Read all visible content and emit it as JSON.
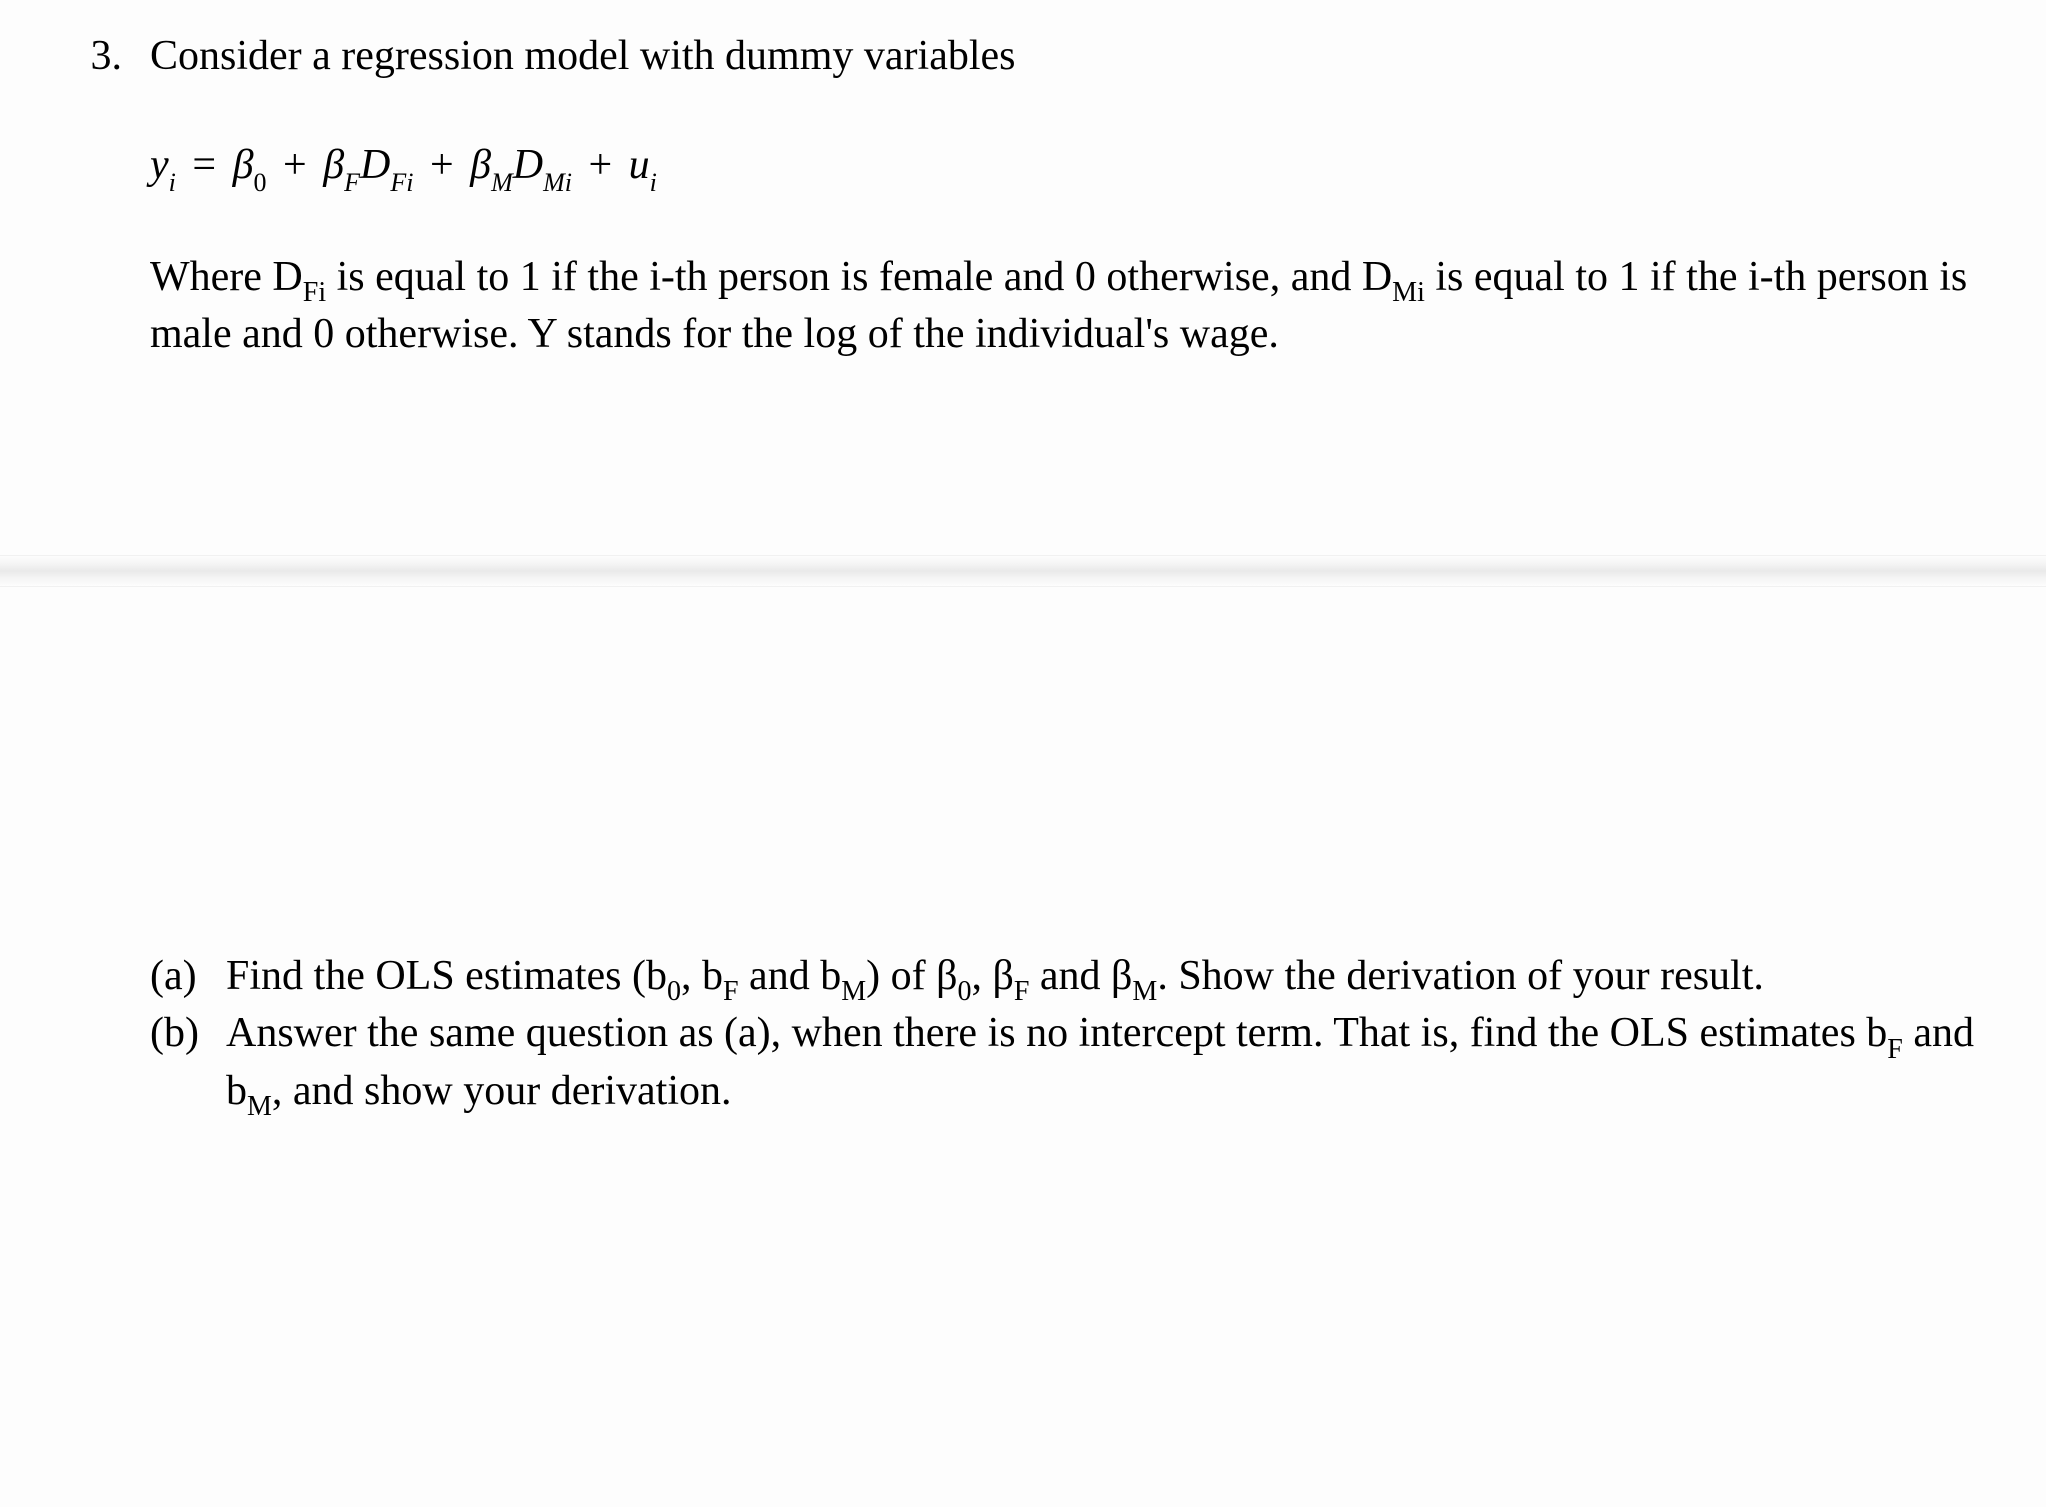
{
  "question": {
    "number": "3.",
    "intro": "Consider a regression model with dummy variables",
    "equation": {
      "lhs_var": "y",
      "lhs_sub": "i",
      "eq": "=",
      "b0": "β",
      "b0_sub": "0",
      "plus1": "+",
      "bF": "β",
      "bF_sub": "F",
      "DF": "D",
      "DF_sub": "Fi",
      "plus2": "+",
      "bM": "β",
      "bM_sub": "M",
      "DM": "D",
      "DM_sub": "Mi",
      "plus3": "+",
      "u": "u",
      "u_sub": "i"
    },
    "explanation_pre": "Where D",
    "explanation_DF_sub": "Fi",
    "explanation_mid1": " is equal to 1 if the i-th person is female and 0 otherwise, and D",
    "explanation_DM_sub": "Mi",
    "explanation_mid2": " is equal to 1 if the i-th person is male and 0 otherwise. Y stands for the log of the individual's wage.",
    "parts": {
      "a": {
        "label": "(a)",
        "pre": "Find the OLS estimates (b",
        "b0_sub": "0",
        "mid1": ", b",
        "bF_sub": "F",
        "mid2": " and b",
        "bM_sub": "M",
        "mid3": ") of β",
        "beta0_sub": "0",
        "mid4": ", β",
        "betaF_sub": "F",
        "mid5": " and β",
        "betaM_sub": "M",
        "mid6": ".  Show the derivation of your result."
      },
      "b": {
        "label": "(b)",
        "pre": "Answer the same question as (a), when there is no intercept term. That is, find the OLS estimates b",
        "bF_sub": "F",
        "mid1": " and b",
        "bM_sub": "M",
        "mid2": ", and show your derivation."
      }
    }
  }
}
